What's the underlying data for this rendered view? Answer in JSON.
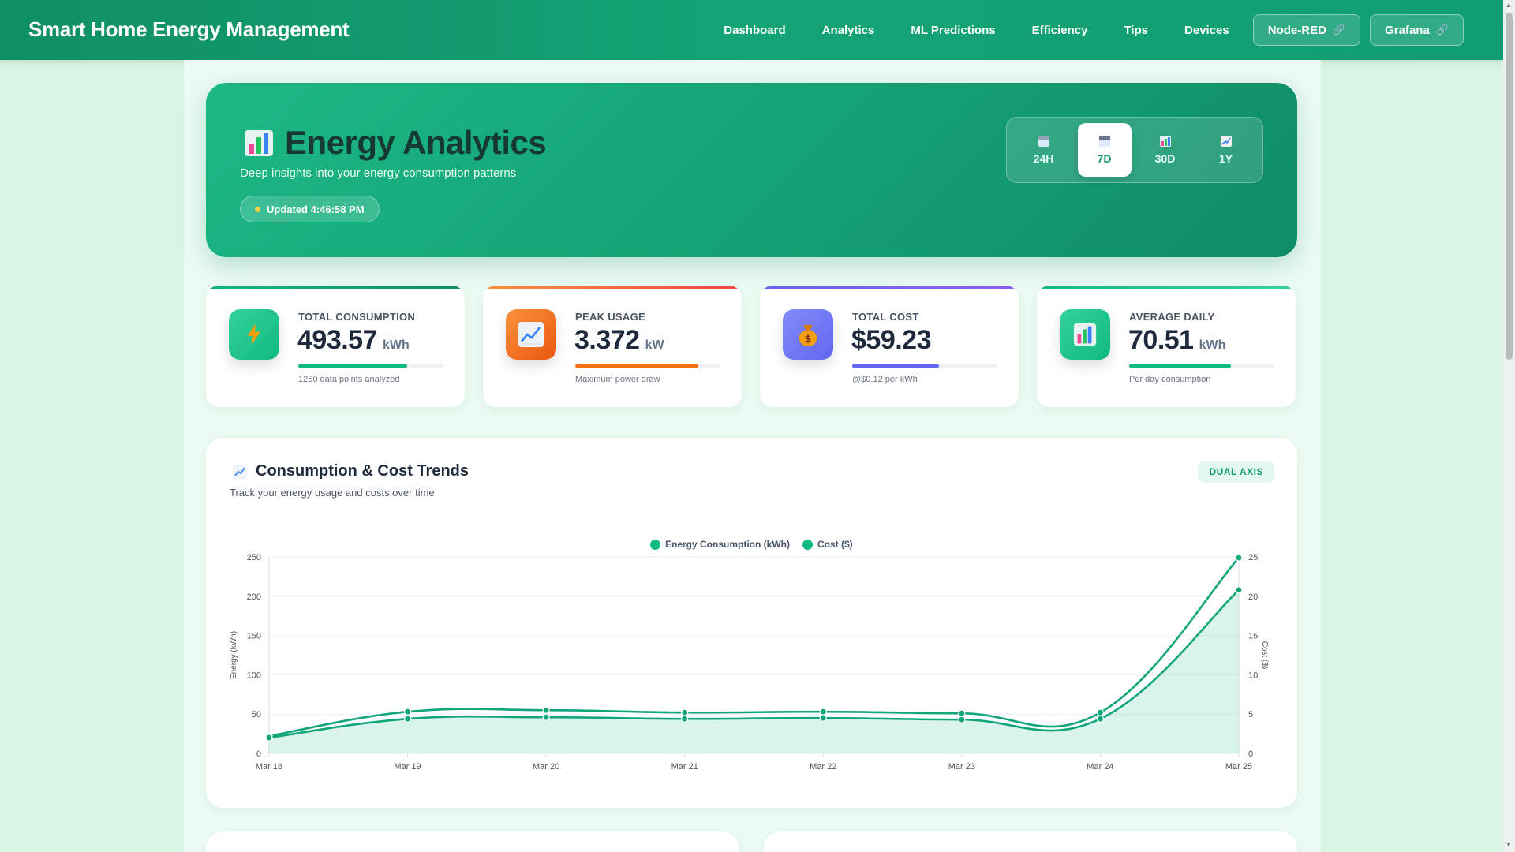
{
  "navbar": {
    "brand": "Smart Home Energy Management",
    "links": [
      "Dashboard",
      "Analytics",
      "ML Predictions",
      "Efficiency",
      "Tips",
      "Devices"
    ],
    "external": [
      "Node-RED",
      "Grafana"
    ]
  },
  "hero": {
    "title": "Energy Analytics",
    "subtitle": "Deep insights into your energy consumption patterns",
    "updated": "Updated 4:46:58 PM",
    "ranges": [
      "24H",
      "7D",
      "30D",
      "1Y"
    ],
    "active_range": "7D"
  },
  "stats": [
    {
      "label": "TOTAL CONSUMPTION",
      "value": "493.57",
      "unit": "kWh",
      "sub": "1250 data points analyzed",
      "progress": 0.75,
      "color": "#10b981",
      "icon": "lightning-icon"
    },
    {
      "label": "PEAK USAGE",
      "value": "3.372",
      "unit": "kW",
      "sub": "Maximum power draw",
      "progress": 0.85,
      "color": "#f97316",
      "icon": "line-chart-icon"
    },
    {
      "label": "TOTAL COST",
      "value": "$59.23",
      "unit": "",
      "sub": "@$0.12 per kWh",
      "progress": 0.6,
      "color": "#6366f1",
      "icon": "money-bag-icon"
    },
    {
      "label": "AVERAGE DAILY",
      "value": "70.51",
      "unit": "kWh",
      "sub": "Per day consumption",
      "progress": 0.7,
      "color": "#10b981",
      "icon": "bar-chart-icon"
    }
  ],
  "panel": {
    "title": "Consumption & Cost Trends",
    "subtitle": "Track your energy usage and costs over time",
    "badge": "DUAL AXIS"
  },
  "chart_data": {
    "type": "line",
    "categories": [
      "Mar 18",
      "Mar 19",
      "Mar 20",
      "Mar 21",
      "Mar 22",
      "Mar 23",
      "Mar 24",
      "Mar 25"
    ],
    "series": [
      {
        "name": "Energy Consumption (kWh)",
        "axis": "left",
        "values": [
          22,
          53,
          55,
          52,
          53,
          51,
          52,
          249
        ]
      },
      {
        "name": "Cost ($)",
        "axis": "right",
        "values": [
          2.0,
          4.4,
          4.6,
          4.4,
          4.5,
          4.3,
          4.4,
          20.8
        ]
      }
    ],
    "ylabel": "Energy (kWh)",
    "y2label": "Cost ($)",
    "ylim": [
      0,
      250
    ],
    "y2lim": [
      0,
      25
    ],
    "yticks": [
      0,
      50,
      100,
      150,
      200,
      250
    ],
    "y2ticks": [
      0,
      5,
      10,
      15,
      20,
      25
    ],
    "color": "#10b981",
    "grid": true,
    "legend": "top-center"
  }
}
